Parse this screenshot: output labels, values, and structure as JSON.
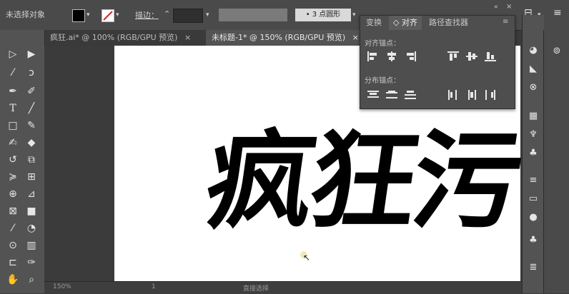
{
  "control_bar": {
    "selection_label": "未选择对象",
    "stroke_label": "描边：",
    "brush_preset": "3 点圆形"
  },
  "doc_tabs": [
    {
      "label": "疯狂.ai* @ 100% (RGB/GPU 预览)",
      "close": "×"
    },
    {
      "label": "未标题-1* @ 150% (RGB/GPU 预览)",
      "close": "×"
    }
  ],
  "align_panel": {
    "tabs": [
      "变换",
      "对齐",
      "路径查找器"
    ],
    "active_tab": "对齐",
    "align_objects_label": "对齐锚点：",
    "distribute_label": "分布锚点："
  },
  "canvas": {
    "artwork_text": "疯狂污"
  },
  "status_bar": {
    "zoom": "150%",
    "page": "1",
    "tool_hint": "直接选择"
  },
  "colors": {
    "ui_bg": "#535353",
    "artboard": "#ffffff",
    "artwork": "#000000"
  }
}
